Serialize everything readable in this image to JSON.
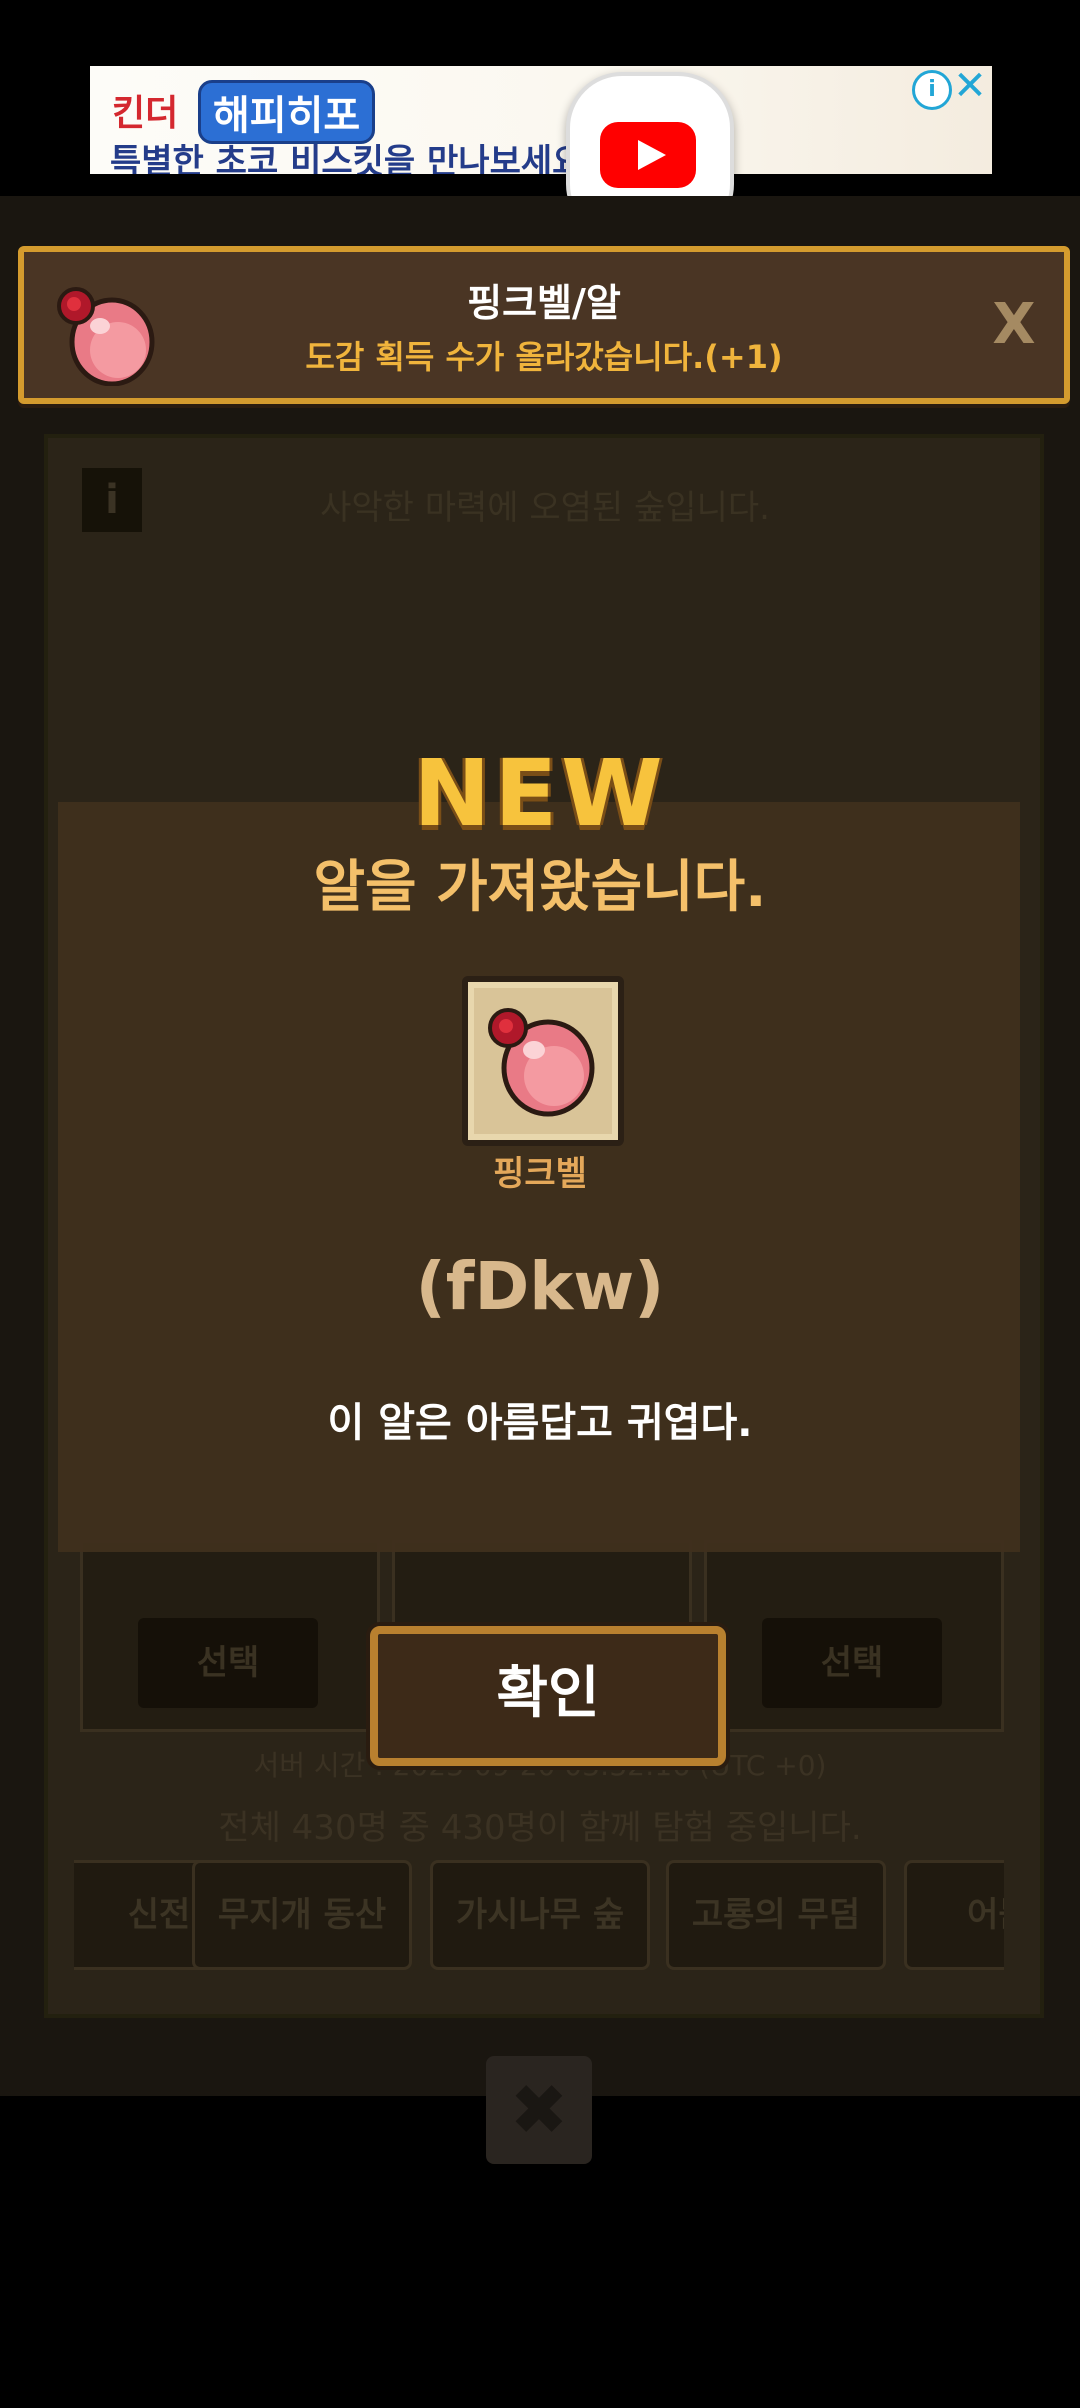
{
  "ad": {
    "brand_prefix": "킨더",
    "brand_logo": "해피히포",
    "subtitle": "특별한 초코 비스킷을 만나보세요",
    "info_icon": "i",
    "close_icon": "✕"
  },
  "youtube": {
    "icon": "youtube-play-icon"
  },
  "notification": {
    "title": "핑크벨/알",
    "subtitle": "도감 획득 수가 올라갔습니다.(+1)",
    "close_label": "X"
  },
  "background": {
    "info_label": "i",
    "heading": "사악한 마력에 오염된 숲입니다.",
    "select_label_left": "선택",
    "select_label_right": "선택",
    "server_time": "서버 시간 : 2023-09-20 03:32:16 (UTC +0)",
    "total_users": "전체 430명 중 430명이 함께 탐험 중입니다.",
    "tabs": [
      "신전",
      "무지개 동산",
      "가시나무 숲",
      "고룡의 무덤",
      "어둠의"
    ],
    "close_label": "✖"
  },
  "modal": {
    "badge": "NEW",
    "message": "알을 가져왔습니다.",
    "egg_name": "핑크벨",
    "egg_code": "(fDkw)",
    "egg_description": "이 알은 아름답고 귀엽다.",
    "confirm_label": "확인"
  },
  "colors": {
    "accent_gold": "#d49b2e",
    "modal_bg": "#3f2f1d",
    "new_badge": "#f7c33d"
  }
}
